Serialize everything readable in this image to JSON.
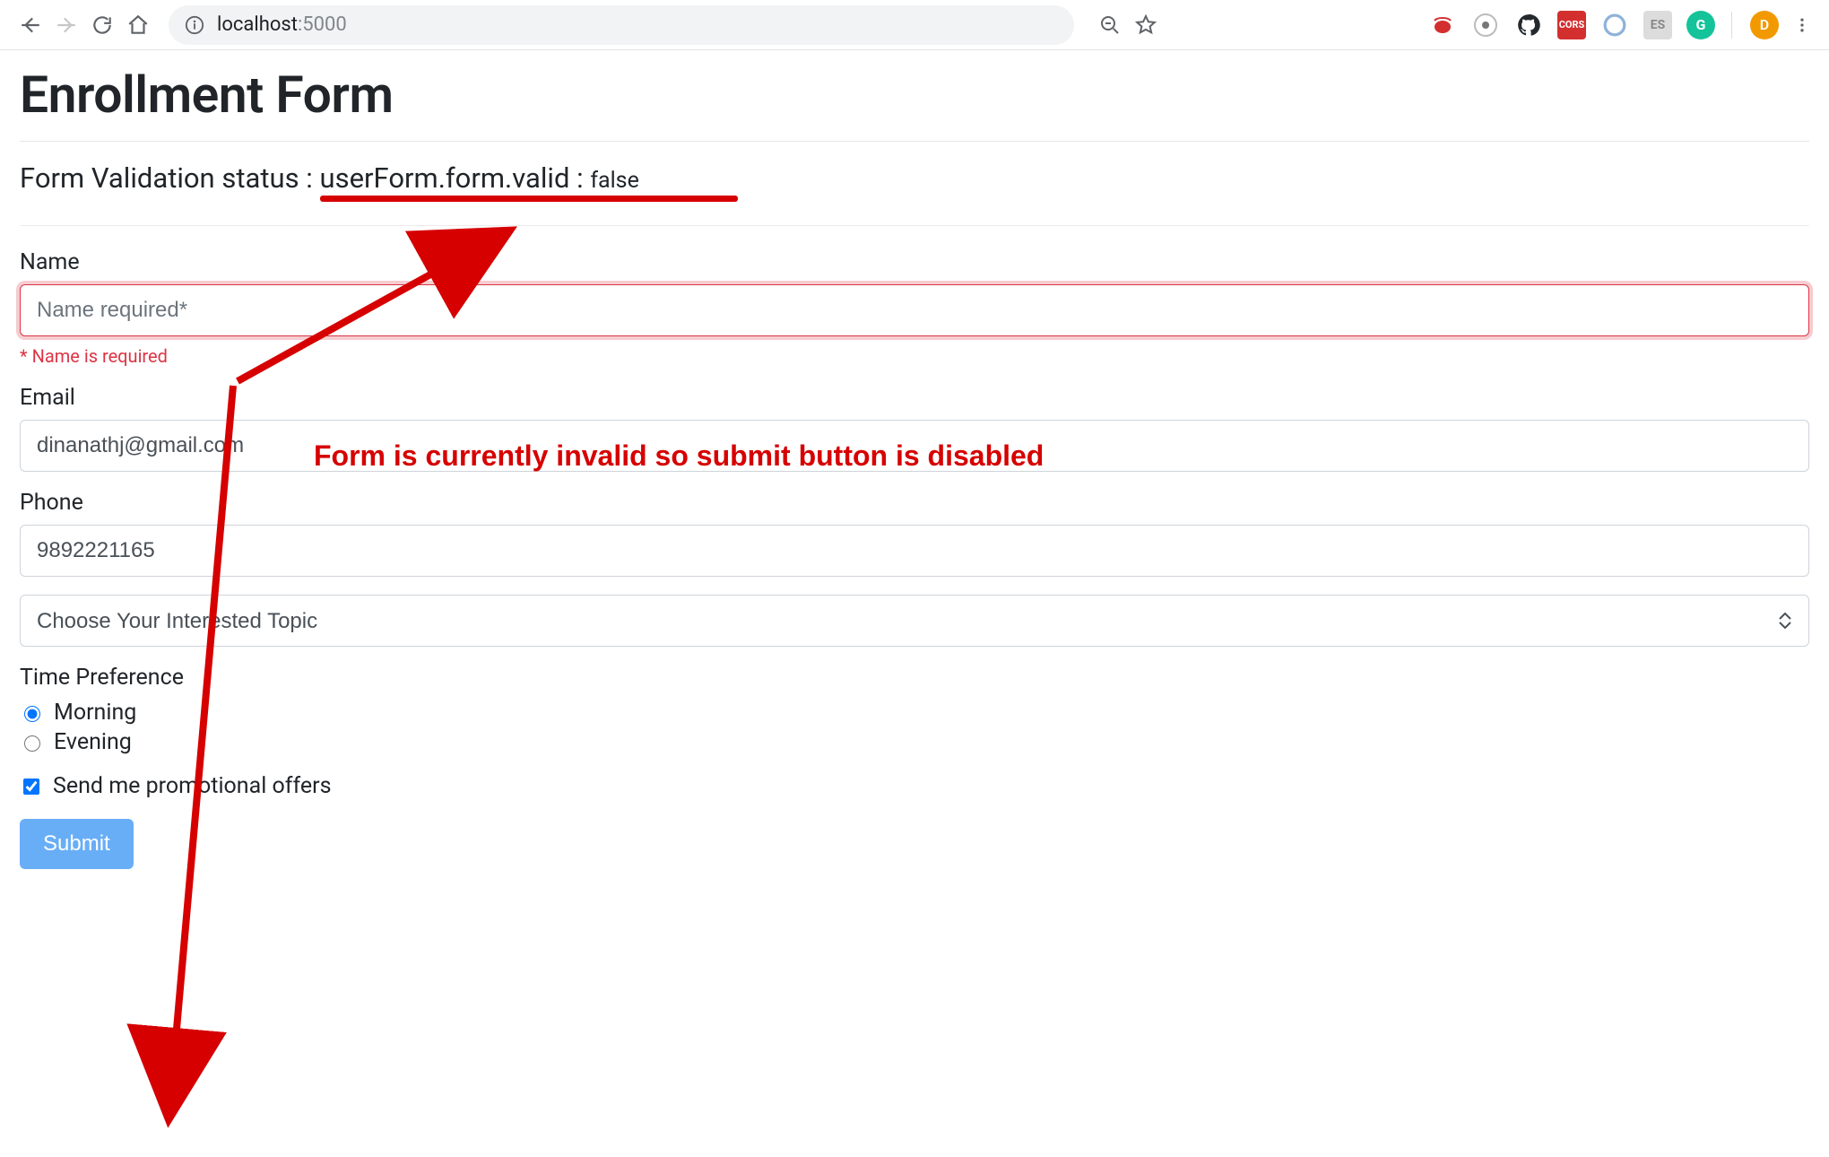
{
  "browser": {
    "url_host": "localhost",
    "url_port": ":5000",
    "avatar_letter": "D",
    "extensions": {
      "cors_label": "CORS",
      "es_label": "ES",
      "grammarly_label": "G"
    }
  },
  "page": {
    "title": "Enrollment Form",
    "status_prefix": "Form Validation status : ",
    "status_expr": "userForm.form.valid : ",
    "status_value": "false"
  },
  "annotation": {
    "invalid_note": "Form is currently invalid so submit button is disabled"
  },
  "form": {
    "name": {
      "label": "Name",
      "placeholder": "Name required*",
      "value": "",
      "error": "* Name is required"
    },
    "email": {
      "label": "Email",
      "value": "dinanathj@gmail.com"
    },
    "phone": {
      "label": "Phone",
      "value": "9892221165"
    },
    "topic": {
      "selected": "Choose Your Interested Topic"
    },
    "time_pref": {
      "label": "Time Preference",
      "options": {
        "morning": "Morning",
        "evening": "Evening"
      },
      "selected": "morning"
    },
    "promo": {
      "label": "Send me promotional offers",
      "checked": true
    },
    "submit_label": "Submit"
  }
}
